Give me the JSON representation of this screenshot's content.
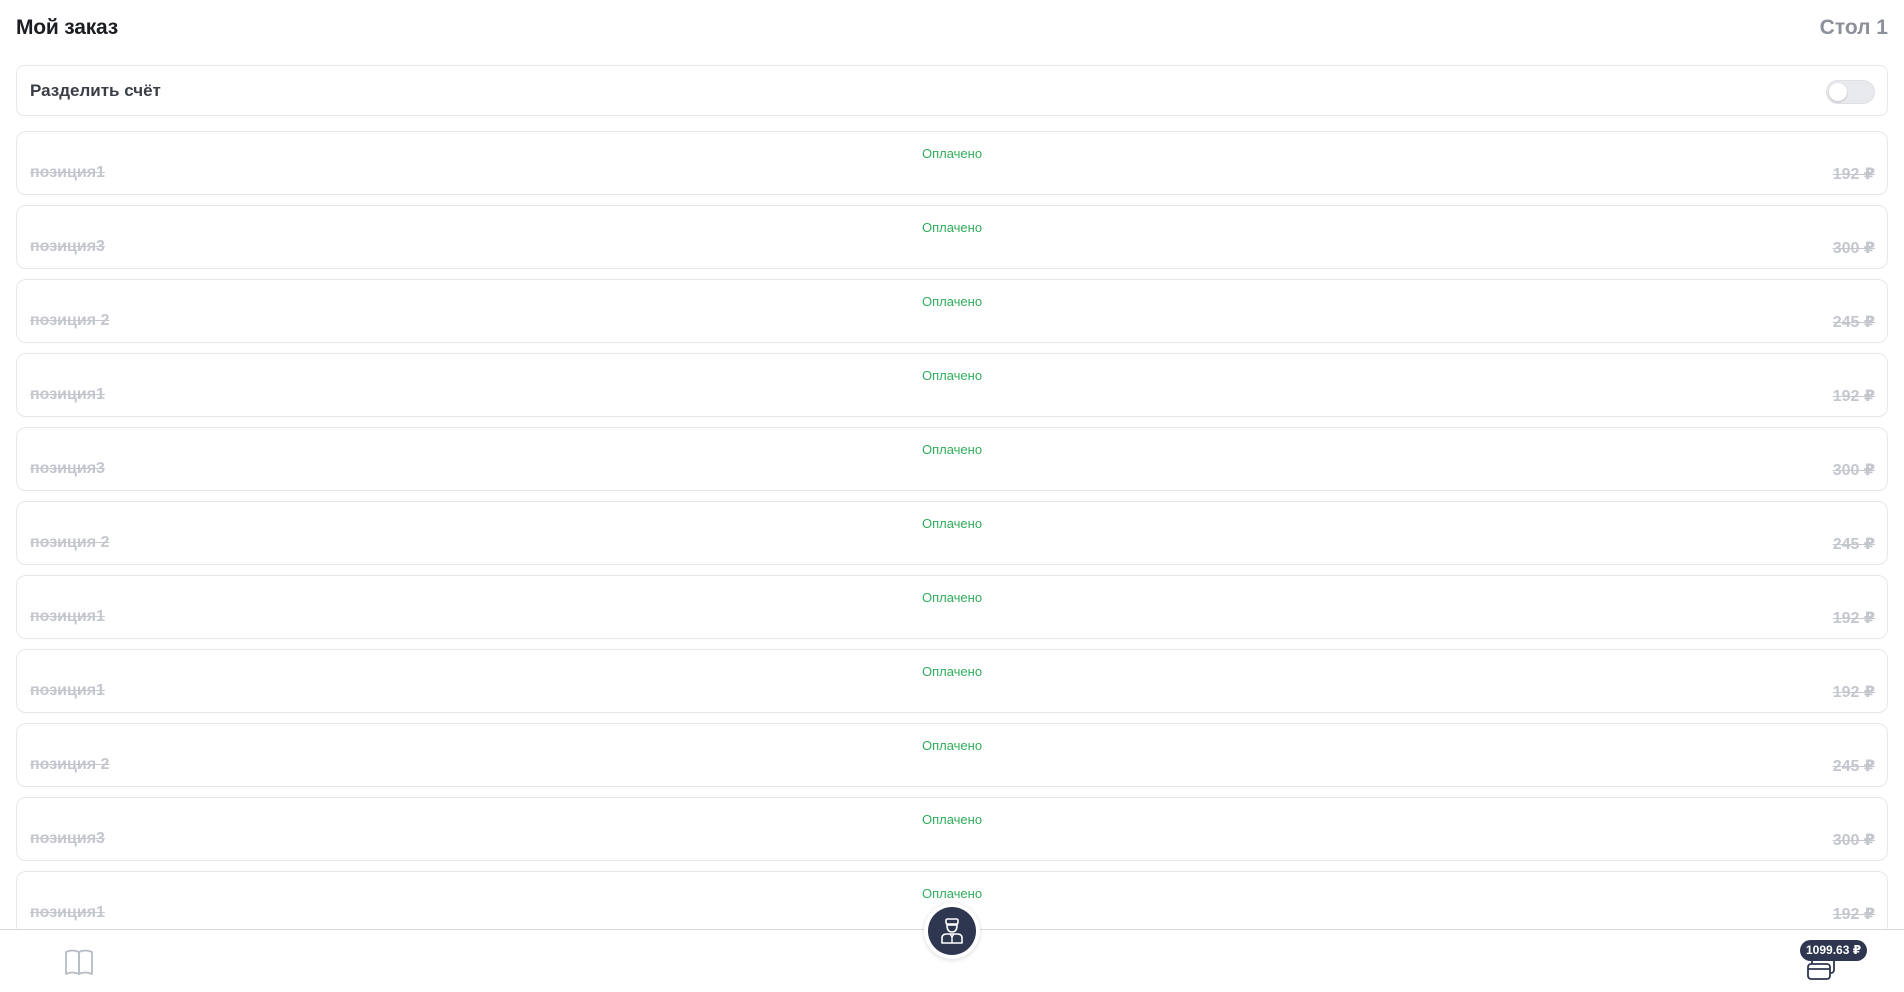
{
  "header": {
    "title": "Мой заказ",
    "table": "Стол 1"
  },
  "split_bill": {
    "label": "Разделить счёт",
    "enabled": false
  },
  "items": [
    {
      "status": "Оплачено",
      "name": "позиция1",
      "price": "192 ₽"
    },
    {
      "status": "Оплачено",
      "name": "позиция3",
      "price": "300 ₽"
    },
    {
      "status": "Оплачено",
      "name": "позиция 2",
      "price": "245 ₽"
    },
    {
      "status": "Оплачено",
      "name": "позиция1",
      "price": "192 ₽"
    },
    {
      "status": "Оплачено",
      "name": "позиция3",
      "price": "300 ₽"
    },
    {
      "status": "Оплачено",
      "name": "позиция 2",
      "price": "245 ₽"
    },
    {
      "status": "Оплачено",
      "name": "позиция1",
      "price": "192 ₽"
    },
    {
      "status": "Оплачено",
      "name": "позиция1",
      "price": "192 ₽"
    },
    {
      "status": "Оплачено",
      "name": "позиция 2",
      "price": "245 ₽"
    },
    {
      "status": "Оплачено",
      "name": "позиция3",
      "price": "300 ₽"
    },
    {
      "status": "Оплачено",
      "name": "позиция1",
      "price": "192 ₽"
    }
  ],
  "bottom_bar": {
    "menu_icon": "open-book-icon",
    "waiter_icon": "waiter-icon",
    "payment_icon": "card-icon",
    "total": "1099.63 ₽"
  },
  "colors": {
    "status_green": "#2fae5a",
    "accent_navy": "#2e3650",
    "muted_text": "#c4c7cd"
  }
}
